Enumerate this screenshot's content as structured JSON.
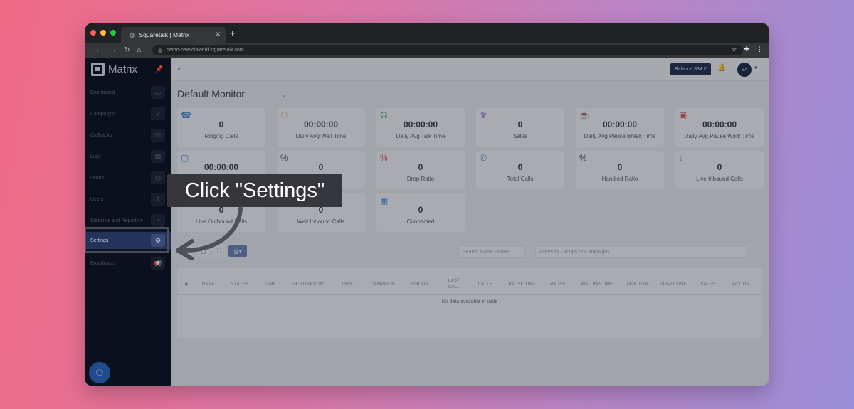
{
  "browser": {
    "tab_title": "Squaretalk | Matrix",
    "tab_close": "✕",
    "new_tab": "+",
    "url": "demo-new-dialer.dl.squaretalk.com",
    "traffic_colors": [
      "#ff5f57",
      "#febc2e",
      "#28c840"
    ]
  },
  "sidebar": {
    "logo_text": "Matrix",
    "items": [
      {
        "label": "Dashboard",
        "icon": "monitor-icon",
        "glyph": "▭"
      },
      {
        "label": "Campaigns",
        "icon": "rocket-icon",
        "glyph": "➶"
      },
      {
        "label": "Callbacks",
        "icon": "phone-callback-icon",
        "glyph": "☏"
      },
      {
        "label": "Lists",
        "icon": "document-icon",
        "glyph": "▤"
      },
      {
        "label": "Leads",
        "icon": "target-icon",
        "glyph": "◎"
      },
      {
        "label": "Users",
        "icon": "user-icon",
        "glyph": "♙"
      },
      {
        "label": "Statistics and Reports",
        "icon": "pie-chart-icon",
        "glyph": "◔"
      },
      {
        "label": "Settings",
        "icon": "gear-icon",
        "glyph": "⚙"
      },
      {
        "label": "Broadcasts",
        "icon": "megaphone-icon",
        "glyph": "📢"
      }
    ],
    "active": "Settings",
    "stats_chevron": "▾"
  },
  "topbar": {
    "balance": "Balance 834 €",
    "avatar": "SA"
  },
  "page": {
    "title": "Default Monitor"
  },
  "cards": [
    {
      "value": "0",
      "label": "Ringing Calls",
      "icon": "ringing-phone-icon",
      "glyph": "☎",
      "color": "#4a8fd6"
    },
    {
      "value": "00:00:00",
      "label": "Daily Avg Wait Time",
      "icon": "wait-users-icon",
      "glyph": "⚇",
      "color": "#e0a04a"
    },
    {
      "value": "00:00:00",
      "label": "Daily Avg Talk Time",
      "icon": "talk-bubble-icon",
      "glyph": "☊",
      "color": "#4cb26a"
    },
    {
      "value": "0",
      "label": "Sales",
      "icon": "trophy-icon",
      "glyph": "♛",
      "color": "#9a7ad0"
    },
    {
      "value": "00:00:00",
      "label": "Daily Avg Pause Break Time",
      "icon": "coffee-icon",
      "glyph": "☕",
      "color": "#e05a5a"
    },
    {
      "value": "00:00:00",
      "label": "Daily Avg Pause Work Time",
      "icon": "briefcase-icon",
      "glyph": "▣",
      "color": "#e05a5a"
    },
    {
      "value": "00:00:00",
      "label": "",
      "icon": "chat-icon",
      "glyph": "▢",
      "color": "#4a8fd6"
    },
    {
      "value": "0",
      "label": "",
      "icon": "percent-icon",
      "glyph": "%",
      "color": "#555a66"
    },
    {
      "value": "0",
      "label": "Drop Ratio",
      "icon": "percent-red-icon",
      "glyph": "%",
      "color": "#e05a5a"
    },
    {
      "value": "0",
      "label": "Total Calls",
      "icon": "phone-icon",
      "glyph": "✆",
      "color": "#4a8fd6"
    },
    {
      "value": "0",
      "label": "Handled Ratio",
      "icon": "percent-dark-icon",
      "glyph": "%",
      "color": "#555a66"
    },
    {
      "value": "0",
      "label": "Live Inbound Calls",
      "icon": "arrow-down-icon",
      "glyph": "↓",
      "color": "#4cb26a"
    },
    {
      "value": "0",
      "label": "Live Outbound Calls",
      "icon": "arrow-up-icon",
      "glyph": "↑",
      "color": "#4a8fd6"
    },
    {
      "value": "0",
      "label": "Wait Inbound Calls",
      "icon": "wait-icon",
      "glyph": "⧗",
      "color": "#4a8fd6"
    },
    {
      "value": "0",
      "label": "Connected",
      "icon": "connected-monitor-icon",
      "glyph": "▦",
      "color": "#4a8fd6"
    }
  ],
  "toolbar": {
    "search_placeholder": "Search Name,Phone",
    "filter_placeholder": "Filters by Groups or Campaigns"
  },
  "table": {
    "headers": [
      "NAME",
      "STATUS",
      "TIME",
      "DESTINATION",
      "TYPE",
      "CAMPAIGN",
      "GROUP",
      "LAST CALL",
      "CALLS",
      "PAUSE TIME",
      "PAUSE",
      "WAITING TIME",
      "TALK TIME",
      "DISPO TIME",
      "SALES",
      "ACTION"
    ],
    "empty": "No data available in table"
  },
  "callout": {
    "text": "Click \"Settings\""
  }
}
